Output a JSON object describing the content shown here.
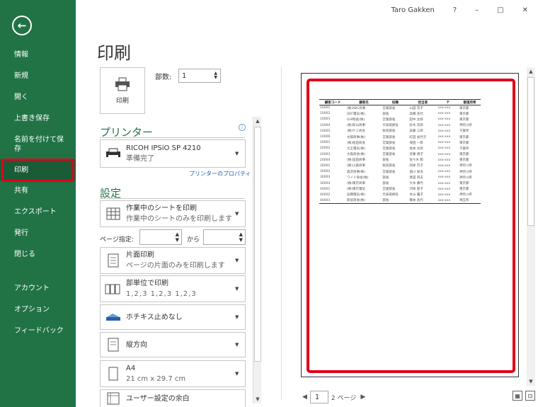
{
  "titlebar": {
    "user": "Taro Gakken",
    "help": "?",
    "minimize": "–",
    "restore": "□",
    "close": "✕"
  },
  "sidebar": {
    "back_icon": "←",
    "items": [
      "情報",
      "新規",
      "開く",
      "上書き保存",
      "名前を付けて保存",
      "印刷",
      "共有",
      "エクスポート",
      "発行",
      "閉じる",
      "アカウント",
      "オプション",
      "フィードバック"
    ],
    "active": "印刷"
  },
  "page": {
    "title": "印刷"
  },
  "print_button": {
    "icon": "printer-icon",
    "label": "印刷"
  },
  "copies": {
    "label": "部数:",
    "value": "1"
  },
  "printer": {
    "section_title": "プリンター",
    "name": "RICOH IPSiO SP 4210",
    "status": "準備完了",
    "properties_link": "プリンターのプロパティ",
    "info_icon": "i"
  },
  "settings": {
    "section_title": "設定",
    "scope": {
      "main": "作業中のシートを印刷",
      "sub": "作業中のシートのみを印刷します"
    },
    "pages_label": "ページ指定:",
    "pages_to": "から",
    "sides": {
      "main": "片面印刷",
      "sub": "ページの片面のみを印刷します"
    },
    "collate": {
      "main": "部単位で印刷",
      "sub": "1,2,3 1,2,3 1,2,3"
    },
    "staple": {
      "main": "ホチキス止めなし"
    },
    "orientation": {
      "main": "縦方向"
    },
    "paper": {
      "main": "A4",
      "sub": "21 cm x 29.7 cm"
    },
    "margins": {
      "main": "ユーザー設定の余白"
    }
  },
  "preview": {
    "headers": [
      "顧客コード",
      "顧客名",
      "役職",
      "担当者",
      "〒",
      "都道府県"
    ],
    "rows": [
      [
        "10001",
        "(株)ABC商事",
        "営業部長",
        "山田 花子",
        "xxx-xxx",
        "東京都"
      ],
      [
        "10002",
        "DEF電気(株)",
        "部長",
        "高橋 浩代",
        "xxx-xxx",
        "東京都"
      ],
      [
        "10003",
        "GHI物産(株)",
        "営業部長",
        "田中 太郎",
        "xxx-xxx",
        "東京都"
      ],
      [
        "10004",
        "(株)新山商事",
        "代表取締役",
        "鈴木 次郎",
        "xxx-xxx",
        "神奈川県"
      ],
      [
        "10005",
        "(株)ケミ商会",
        "販売部長",
        "安藤 三郎",
        "xxx-xxx",
        "千葉県"
      ],
      [
        "10006",
        "太陽商事(株)",
        "営業部長",
        "町田 加代子",
        "xxx-xxx",
        "東京都"
      ],
      [
        "20001",
        "(株)松田商会",
        "営業部長",
        "保田 一郎",
        "xxx-xxx",
        "東京都"
      ],
      [
        "20002",
        "大正電気(株)",
        "営業部長",
        "坂本 太郎",
        "xxx-xxx",
        "千葉県"
      ],
      [
        "20003",
        "大森商会(株)",
        "営業部長",
        "近藤 明子",
        "xxx-xxx",
        "東京都"
      ],
      [
        "20004",
        "(株)島田商事",
        "部長",
        "佐々木 駒",
        "xxx-xxx",
        "東京都"
      ],
      [
        "30001",
        "(株)小森商事",
        "販売部長",
        "岡本 京子",
        "xxx-xxx",
        "神奈川県"
      ],
      [
        "30002",
        "森沢商事(株)",
        "営業部長",
        "堀川 栄治",
        "xxx-xxx",
        "神奈川県"
      ],
      [
        "30003",
        "ワイド商会(株)",
        "部長",
        "黒田 邦夫",
        "xxx-xxx",
        "神奈川県"
      ],
      [
        "30004",
        "(株)東京商事",
        "部長",
        "大木 康代",
        "xxx-xxx",
        "東京都"
      ],
      [
        "40001",
        "(株)東京電気",
        "営業部長",
        "河本 愛子",
        "xxx-xxx",
        "東京都"
      ],
      [
        "40002",
        "呉橋電気(株)",
        "代表取締役",
        "木山 優子",
        "xxx-xxx",
        "神奈川県"
      ],
      [
        "40003",
        "新宿商会(株)",
        "部長",
        "橋本 浩代",
        "xxx-xxx",
        "埼玉県"
      ]
    ]
  },
  "pager": {
    "prev": "◀",
    "current": "1",
    "total": "2 ページ",
    "next": "▶"
  }
}
